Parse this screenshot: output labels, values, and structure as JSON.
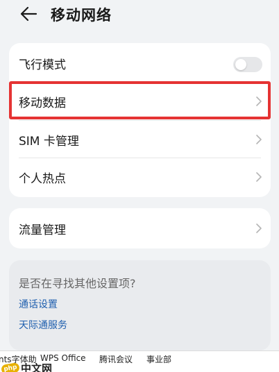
{
  "header": {
    "title": "移动网络",
    "back_icon": "arrow-left-icon"
  },
  "settings": {
    "airplane_mode": {
      "label": "飞行模式",
      "toggle_on": false
    },
    "mobile_data": {
      "label": "移动数据",
      "highlighted": true
    },
    "sim_management": {
      "label": "SIM 卡管理"
    },
    "hotspot": {
      "label": "个人热点"
    },
    "traffic_management": {
      "label": "流量管理"
    }
  },
  "suggestions": {
    "title": "是否在寻找其他设置项?",
    "links": [
      "通话设置",
      "天际通服务"
    ]
  },
  "taskbar": {
    "items": [
      "nts字体助",
      "WPS Office",
      "腾讯会议",
      "事业部"
    ],
    "logo_mark": "php",
    "logo_text": "中文网"
  },
  "colors": {
    "highlight": "#e53333",
    "link": "#1f5fae",
    "background": "#f1f3f5"
  }
}
